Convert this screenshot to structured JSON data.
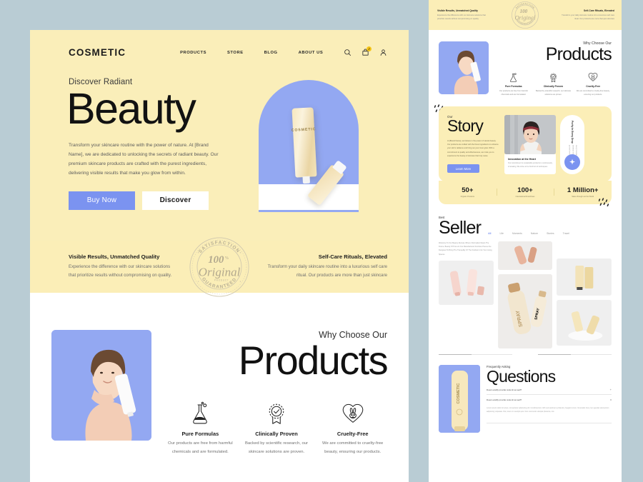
{
  "brand": {
    "logo": "COSMETIC"
  },
  "nav": {
    "links": [
      "PRODUCTS",
      "STORE",
      "BLOG",
      "ABOUT US"
    ],
    "cart_count": "2",
    "icons": [
      "search-icon",
      "cart-icon",
      "account-icon"
    ]
  },
  "hero": {
    "eyebrow": "Discover Radiant",
    "title": "Beauty",
    "paragraph": "Transform your skincare routine with the power of nature. At [Brand Name], we are dedicated to unlocking the secrets of radiant beauty. Our premium skincare products are crafted with the purest ingredients, delivering visible results that make you glow from within.",
    "primary_button": "Buy Now",
    "secondary_button": "Discover",
    "product_label": "COSMETIC"
  },
  "banner": {
    "left_heading": "Visible Results, Unmatched Quality",
    "left_text": "Experience the difference with our skincare solutions that prioritize results without compromising on quality.",
    "right_heading": "Self-Care Rituals, Elevated",
    "right_text": "Transform your daily skincare routine into a luxurious self care ritual. Our products are more than just skincare",
    "seal": {
      "top_arc": "SATISFACTION",
      "bottom_arc": "GUARANTEED",
      "percent": "100",
      "percent_symbol": "%",
      "word": "Original",
      "sub": "PRODUCT"
    }
  },
  "why_choose": {
    "eyebrow": "Why Choose Our",
    "title": "Products",
    "features": [
      {
        "icon": "flask-icon",
        "heading": "Pure Formulas",
        "text": "Our products are free from harmful chemicals and are formulated."
      },
      {
        "icon": "badge-check-icon",
        "heading": "Clinically Proven",
        "text": "Backed by scientific research, our skincare solutions are proven."
      },
      {
        "icon": "heart-rabbit-icon",
        "heading": "Cruelty-Free",
        "text": "We are committed to cruelty-free beauty, ensuring our products."
      }
    ]
  },
  "story": {
    "eyebrow": "Our",
    "title": "Story",
    "paragraph": "At [Brand Name], we believe in the power of natural beauty. Our products are crafted with the finest ingredients to enhance your skin's radiance and bring out your inner glow. With a commitment to quality and effectiveness, we invite you to experience the beauty of skincare that truly cares.",
    "button": "Learn More",
    "card_heading": "Innovation at the Heart",
    "card_text": "Our commitment to sustainable products is continuously innovating. We strive to be forefront of techniques.",
    "side_heading": "Purity In Every Drop",
    "side_text": "Every formula is crafted with pure botanical extracts chosen for their proven benefits and gentle care.",
    "fab_icon": "sparkle-icon"
  },
  "stats": [
    {
      "number": "50+",
      "label": "Organic Products"
    },
    {
      "number": "100+",
      "label": "International Franchises"
    },
    {
      "number": "1 Million+",
      "label": "Sales through out the World"
    }
  ],
  "best_seller": {
    "eyebrow": "Best",
    "title": "Seller",
    "tabs": [
      "All",
      "Life",
      "Moments",
      "Nature",
      "Stories",
      "Travel"
    ],
    "active_tab": "All",
    "intro": "Welcome To Our Beauty Revival, Where Information Meets The Future. Beauty Of Pure An Our Manufactured Furniture Pieces Are Designed To Bring The Tranquility Of The Outdoors Into Your Living Spaces."
  },
  "faq": {
    "eyebrow": "Frequently Asking",
    "title": "Questions",
    "items": [
      {
        "question": "Does Landify provide code kit as well?",
        "sign": "+",
        "answer": ""
      },
      {
        "question": "Does Landify provide code kit as well?",
        "sign": "x",
        "answer": "Lorem ipsum dolor sit amet, consectetur adipiscing elit. Condimentum nibh sed pulvinar a pharetra, feugiat cursus. Venenatis risus, leo egestas elementum adipiscing vulputate. Nisi, lorem in suscipit quis. Non commodo volutpat pharetra, nisi."
      }
    ],
    "product_label": "COSMETIC"
  },
  "colors": {
    "cream": "#faeeb9",
    "banner_cream": "#fbeeb7",
    "periwinkle": "#7b93f0",
    "photo_blue": "#93a8f2",
    "page_bg": "#b9ccd4",
    "ink": "#111111"
  }
}
